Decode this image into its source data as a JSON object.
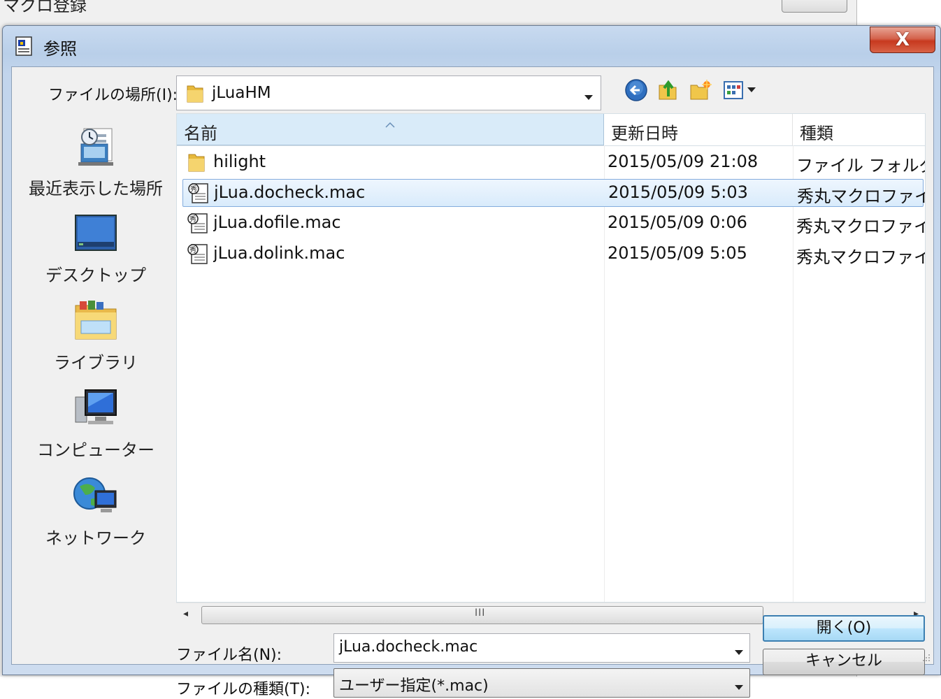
{
  "parent": {
    "title": "マクロ登録"
  },
  "dialog": {
    "title": "参照",
    "close_label": "X"
  },
  "look_in": {
    "label": "ファイルの場所(I):",
    "value": "jLuaHM"
  },
  "toolbar": {
    "icons": [
      "back-icon",
      "up-folder-icon",
      "new-folder-icon",
      "view-menu-icon"
    ]
  },
  "places": [
    {
      "label": "最近表示した場所",
      "icon": "recent-places-icon"
    },
    {
      "label": "デスクトップ",
      "icon": "desktop-icon"
    },
    {
      "label": "ライブラリ",
      "icon": "libraries-icon"
    },
    {
      "label": "コンピューター",
      "icon": "computer-icon"
    },
    {
      "label": "ネットワーク",
      "icon": "network-icon"
    }
  ],
  "columns": {
    "name": "名前",
    "date": "更新日時",
    "type": "種類"
  },
  "files": [
    {
      "name": "hilight",
      "date": "2015/05/09 21:08",
      "type": "ファイル フォルダー",
      "icon": "folder-icon",
      "selected": false
    },
    {
      "name": "jLua.docheck.mac",
      "date": "2015/05/09 5:03",
      "type": "秀丸マクロファイル",
      "icon": "macro-file-icon",
      "selected": true
    },
    {
      "name": "jLua.dofile.mac",
      "date": "2015/05/09 0:06",
      "type": "秀丸マクロファイル",
      "icon": "macro-file-icon",
      "selected": false
    },
    {
      "name": "jLua.dolink.mac",
      "date": "2015/05/09 5:05",
      "type": "秀丸マクロファイル",
      "icon": "macro-file-icon",
      "selected": false
    }
  ],
  "scrollbar": {
    "left_arrow": "◂",
    "right_arrow": "▸",
    "grip": "III"
  },
  "filename": {
    "label": "ファイル名(N):",
    "value": "jLua.docheck.mac"
  },
  "filetype": {
    "label": "ファイルの種類(T):",
    "value": "ユーザー指定(*.mac)"
  },
  "buttons": {
    "open": "開く(O)",
    "cancel": "キャンセル"
  }
}
